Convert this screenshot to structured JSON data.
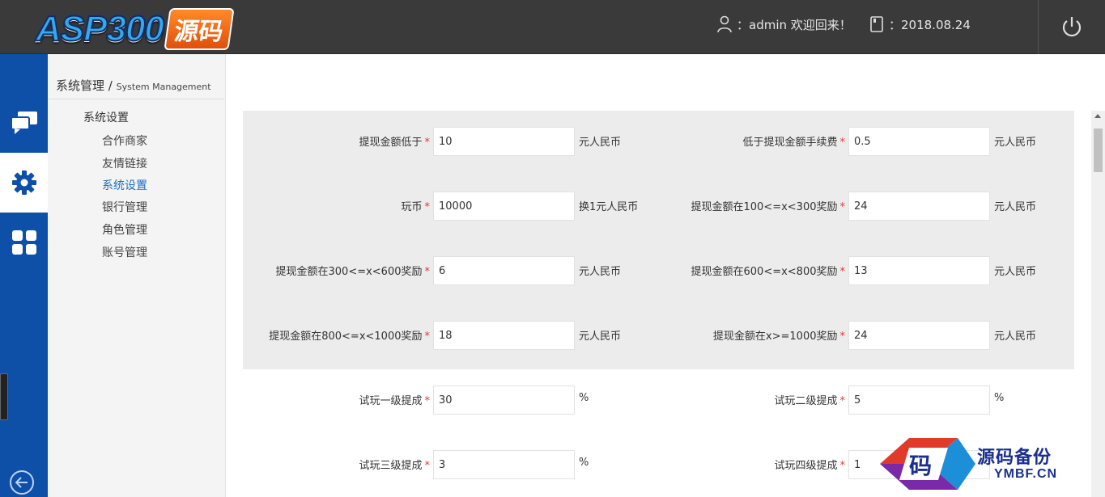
{
  "header": {
    "logo_text": "ASP300",
    "logo_badge": "源码",
    "user_text": "：admin 欢迎回来！",
    "date_text": "：2018.08.24"
  },
  "colors": {
    "header_bg": "#3a3a3a",
    "iconbar_bg": "#0e4fa8",
    "active_menu": "#1e6fbf",
    "required": "#e33333",
    "panel_bg": "#ececec"
  },
  "iconbar": {
    "items": [
      {
        "icon": "chat-icon"
      },
      {
        "icon": "gear-icon"
      },
      {
        "icon": "grid-icon"
      }
    ],
    "back_icon": "arrow-left-circle-icon"
  },
  "sidemenu": {
    "title": "系统管理 / ",
    "title_sub": "System Management",
    "group": "系统设置",
    "items": [
      {
        "label": "合作商家"
      },
      {
        "label": "友情链接"
      },
      {
        "label": "系统设置"
      },
      {
        "label": "银行管理"
      },
      {
        "label": "角色管理"
      },
      {
        "label": "账号管理"
      }
    ]
  },
  "form": {
    "fields": [
      {
        "label": "提现金额低于",
        "value": "10",
        "unit": "元人民币"
      },
      {
        "label": "低于提现金额手续费",
        "value": "0.5",
        "unit": "元人民币"
      },
      {
        "label": "玩币",
        "value": "10000",
        "unit": "换1元人民币"
      },
      {
        "label": "提现金额在100<=x<300奖励",
        "value": "24",
        "unit": "元人民币"
      },
      {
        "label": "提现金额在300<=x<600奖励",
        "value": "6",
        "unit": "元人民币"
      },
      {
        "label": "提现金额在600<=x<800奖励",
        "value": "13",
        "unit": "元人民币"
      },
      {
        "label": "提现金额在800<=x<1000奖励",
        "value": "18",
        "unit": "元人民币"
      },
      {
        "label": "提现金额在x>=1000奖励",
        "value": "24",
        "unit": "元人民币"
      },
      {
        "label": "试玩一级提成",
        "value": "30",
        "unit": "%"
      },
      {
        "label": "试玩二级提成",
        "value": "5",
        "unit": "%"
      },
      {
        "label": "试玩三级提成",
        "value": "3",
        "unit": "%"
      },
      {
        "label": "试玩四级提成",
        "value": "1",
        "unit": ""
      }
    ],
    "required_mark": "*"
  },
  "watermark": {
    "line1": "源码备份",
    "line2": "YMBF.CN",
    "glyph": "码"
  }
}
